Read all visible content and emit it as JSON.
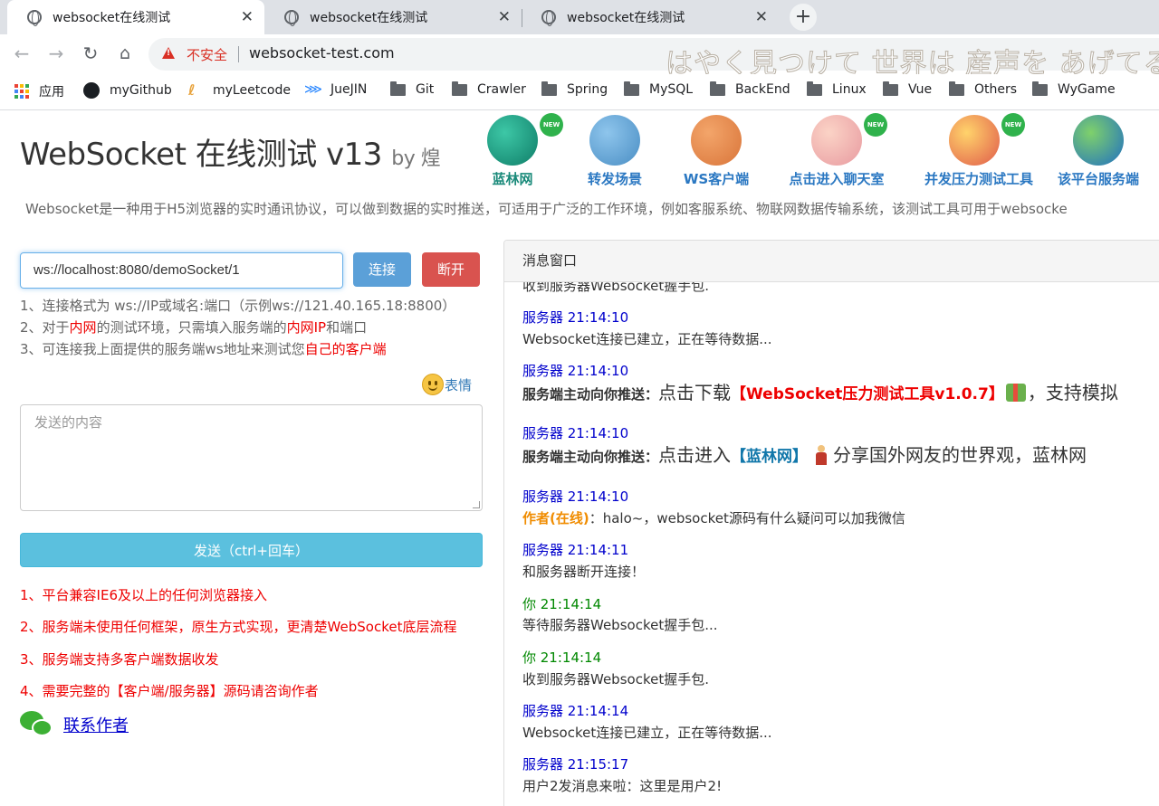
{
  "browser": {
    "tabs": [
      {
        "title": "websocket在线测试",
        "active": true
      },
      {
        "title": "websocket在线测试",
        "active": false
      },
      {
        "title": "websocket在线测试",
        "active": false
      }
    ],
    "new_tab": "+",
    "close_glyph": "✕",
    "security_label": "不安全",
    "url": "websocket-test.com",
    "overlay_text": "はやく見つけて 世界は 産声を あげてる",
    "bookmarks": [
      "应用",
      "myGithub",
      "myLeetcode",
      "JueJIN",
      "Git",
      "Crawler",
      "Spring",
      "MySQL",
      "BackEnd",
      "Linux",
      "Vue",
      "Others",
      "WyGame"
    ]
  },
  "header": {
    "title": "WebSocket 在线测试 v13",
    "by": "by 煌",
    "features": [
      {
        "label": "蓝林网",
        "icon": "globe-icon",
        "new": true,
        "color": "#1a8a7a"
      },
      {
        "label": "转发场景",
        "icon": "antenna-icon",
        "new": false,
        "color": "#2b78c2"
      },
      {
        "label": "WS客户端",
        "icon": "speaker-icon",
        "new": false,
        "color": "#2b78c2"
      },
      {
        "label": "点击进入聊天室",
        "icon": "chat-users-icon",
        "new": true,
        "color": "#2b78c2"
      },
      {
        "label": "并发压力测试工具",
        "icon": "pencil-ruler-icon",
        "new": true,
        "color": "#2b78c2"
      },
      {
        "label": "该平台服务端",
        "icon": "earth-icon",
        "new": false,
        "color": "#2b78c2"
      }
    ],
    "new_badge": "NEW",
    "description": "Websocket是一种用于H5浏览器的实时通讯协议，可以做到数据的实时推送，可适用于广泛的工作环境，例如客服系统、物联网数据传输系统，该测试工具可用于websocke"
  },
  "connect": {
    "ws_url": "ws://localhost:8080/demoSocket/1",
    "connect_label": "连接",
    "disconnect_label": "断开"
  },
  "hints": {
    "h1": "1、连接格式为 ws://IP或域名:端口（示例ws://121.40.165.18:8800）",
    "h2_a": "2、对于",
    "h2_b": "内网",
    "h2_c": "的测试环境，只需填入服务端的",
    "h2_d": "内网IP",
    "h2_e": "和端口",
    "h3_a": "3、可连接我上面提供的服务端ws地址来测试您",
    "h3_b": "自己的客户端"
  },
  "emoji_label": "表情",
  "send": {
    "placeholder": "发送的内容",
    "button": "发送（ctrl+回车）"
  },
  "notes": [
    "1、平台兼容IE6及以上的任何浏览器接入",
    "2、服务端未使用任何框架，原生方式实现，更清楚WebSocket底层流程",
    "3、服务端支持多客户端数据收发",
    "4、需要完整的【客户端/服务器】源码请咨询作者"
  ],
  "contact_label": "联系作者",
  "messages": {
    "header": "消息窗口",
    "m0": "收到服务器Websocket握手包.",
    "m1_who": "服务器 21:14:10",
    "m1_text": "Websocket连接已建立，正在等待数据...",
    "m2_who": "服务器 21:14:10",
    "m2_prefix": "服务端主动向你推送：",
    "m2_a": "点击下载",
    "m2_b": "【WebSocket压力测试工具v1.0.7】",
    "m2_c": "，支持模拟",
    "m3_who": "服务器 21:14:10",
    "m3_prefix": "服务端主动向你推送：",
    "m3_a": "点击进入",
    "m3_b": "【蓝林网】",
    "m3_c": "分享国外网友的世界观，蓝林网",
    "m4_who": "服务器 21:14:10",
    "m4_author": "作者(在线)",
    "m4_text": "：halo~，websocket源码有什么疑问可以加我微信",
    "m5_who": "服务器 21:14:11",
    "m5_text": "和服务器断开连接！",
    "m6_who": "你 21:14:14",
    "m6_text": "等待服务器Websocket握手包...",
    "m7_who": "你 21:14:14",
    "m7_text": "收到服务器Websocket握手包.",
    "m8_who": "服务器 21:14:14",
    "m8_text": "Websocket连接已建立，正在等待数据...",
    "m9_who": "服务器 21:15:17",
    "m9_text": "用户2发消息来啦：这里是用户2!"
  },
  "colors": {
    "accent_blue": "#337ab7",
    "danger": "#d9534f",
    "info": "#5bc0de",
    "server_name": "#0000cc",
    "you_name": "#008800",
    "author_name": "#f08c00"
  }
}
